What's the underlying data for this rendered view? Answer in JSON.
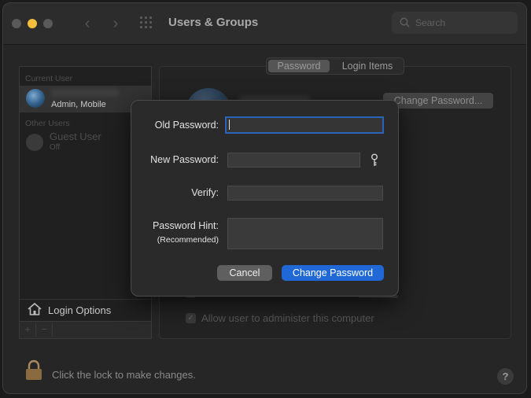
{
  "window": {
    "title": "Users & Groups",
    "search_placeholder": "Search"
  },
  "sidebar": {
    "current_user_label": "Current User",
    "current_user_role": "Admin, Mobile",
    "other_users_label": "Other Users",
    "guest_name": "Guest User",
    "guest_status": "Off",
    "login_options": "Login Options",
    "add_label": "+",
    "remove_label": "−"
  },
  "main": {
    "tabs": [
      "Password",
      "Login Items"
    ],
    "change_password_button": "Change Password...",
    "admin_checkbox_label": "Allow user to administer this computer"
  },
  "footer": {
    "lock_text": "Click the lock to make changes.",
    "help": "?"
  },
  "dialog": {
    "old_password_label": "Old Password:",
    "new_password_label": "New Password:",
    "verify_label": "Verify:",
    "hint_label": "Password Hint:",
    "hint_sub": "(Recommended)",
    "cancel": "Cancel",
    "change": "Change Password"
  }
}
